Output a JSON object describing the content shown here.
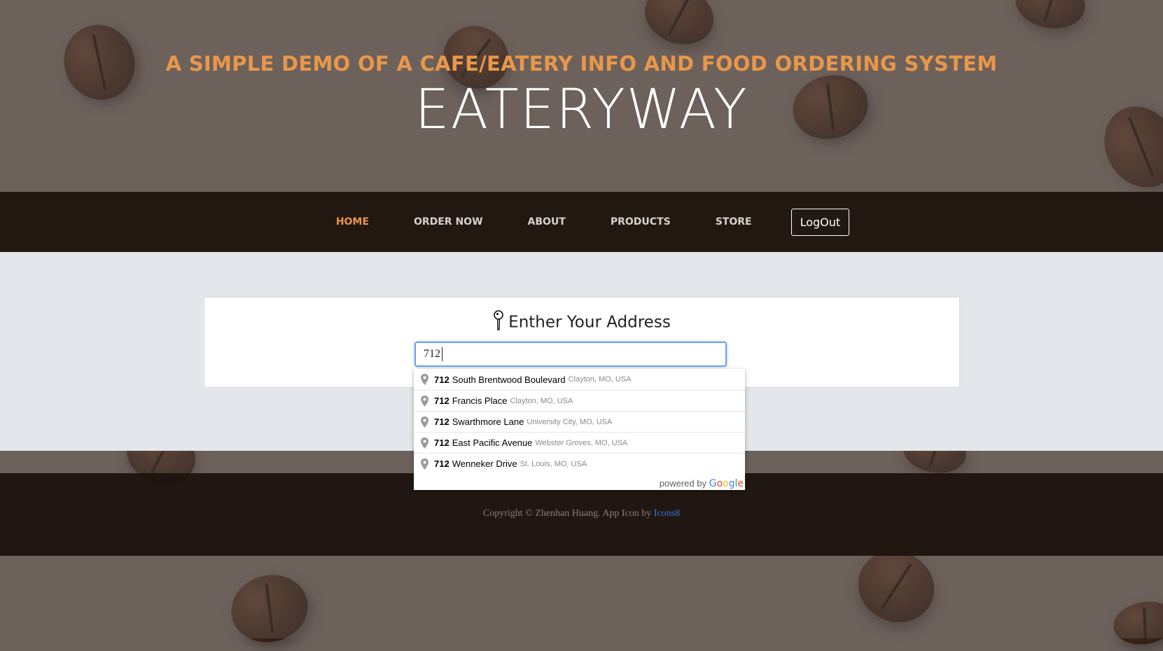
{
  "hero": {
    "tagline": "A SIMPLE DEMO OF A CAFE/EATERY INFO AND FOOD ORDERING SYSTEM",
    "brand": "EATERYWAY"
  },
  "nav": {
    "items": [
      {
        "label": "HOME",
        "active": true
      },
      {
        "label": "ORDER NOW",
        "active": false
      },
      {
        "label": "ABOUT",
        "active": false
      },
      {
        "label": "PRODUCTS",
        "active": false
      },
      {
        "label": "STORE",
        "active": false
      }
    ],
    "logout_label": "LogOut"
  },
  "address_card": {
    "title": "Enther Your Address",
    "icon": "map-pin-icon",
    "input_value": "712"
  },
  "autocomplete": {
    "suggestions": [
      {
        "number": "712",
        "street": "South Brentwood Boulevard",
        "secondary": "Clayton, MO, USA"
      },
      {
        "number": "712",
        "street": "Francis Place",
        "secondary": "Clayton, MO, USA"
      },
      {
        "number": "712",
        "street": "Swarthmore Lane",
        "secondary": "University City, MO, USA"
      },
      {
        "number": "712",
        "street": "East Pacific Avenue",
        "secondary": "Webster Groves, MO, USA"
      },
      {
        "number": "712",
        "street": "Wenneker Drive",
        "secondary": "St. Louis, MO, USA"
      }
    ],
    "powered_by": "powered by",
    "google_letters": [
      "G",
      "o",
      "o",
      "g",
      "l",
      "e"
    ]
  },
  "footer": {
    "copyright": "Copyright © Zhenhan Huang. App Icon by",
    "link_label": "Icons8"
  },
  "colors": {
    "accent": "#e8974a",
    "nav_bg": "#1e130e",
    "content_bg": "#e3e6ea",
    "link": "#3a7bd5",
    "google": [
      "#4285f4",
      "#ea4335",
      "#fbbc05",
      "#4285f4",
      "#34a853",
      "#ea4335"
    ]
  }
}
